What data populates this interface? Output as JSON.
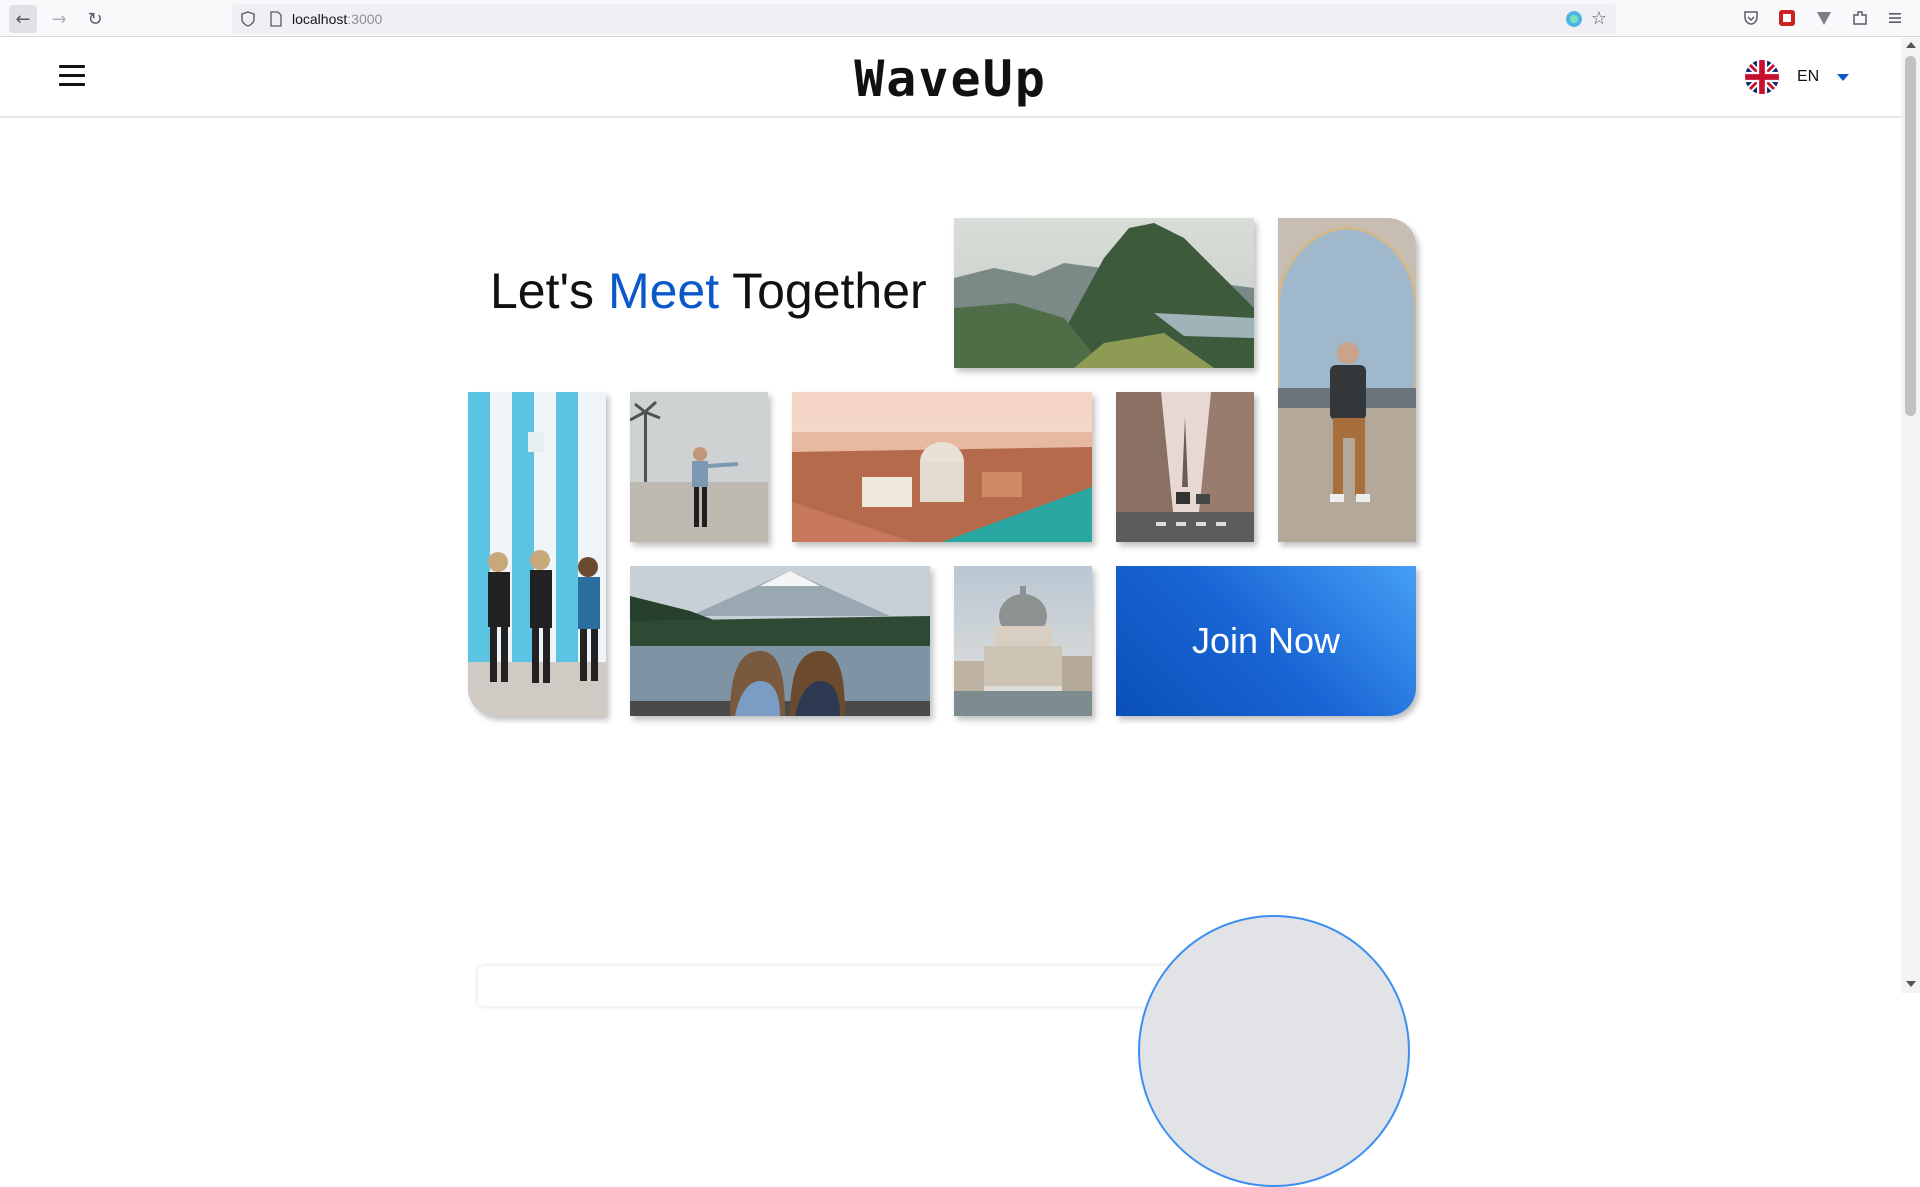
{
  "browser": {
    "url_host": "localhost",
    "url_port": ":3000"
  },
  "header": {
    "logo": "WaveUp",
    "language_code": "EN",
    "flag_icon": "uk-flag-icon",
    "menu_icon": "hamburger-menu-icon"
  },
  "hero": {
    "title_part1": "Let's ",
    "title_accent": "Meet",
    "title_part2": " Together",
    "accent_color": "#0a58ca",
    "cta_label": "Join Now"
  },
  "gallery": {
    "images": [
      "mountain-landscape-photo",
      "man-sitting-arch-photo",
      "friends-striped-wall-photo",
      "man-beach-photo",
      "venice-aerial-photo",
      "paris-street-photo",
      "girls-lake-mountain-photo",
      "venice-basilica-photo"
    ]
  }
}
